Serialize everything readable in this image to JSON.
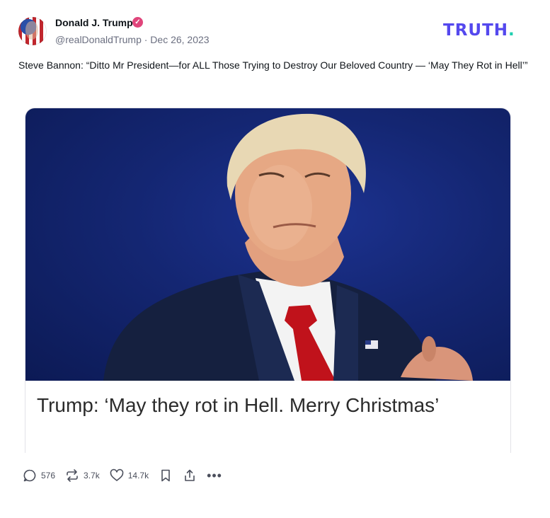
{
  "author": {
    "display_name": "Donald J. Trump",
    "handle_date": "@realDonaldTrump · Dec 26, 2023",
    "avatar_icon": "flag-portrait-avatar",
    "verified_icon": "verified-badge-icon",
    "verified_glyph": "✓"
  },
  "brand": {
    "logo_text": "TRUTH",
    "logo_dot": ".",
    "logo_color": "#5448ee",
    "dot_color": "#1fcfb0"
  },
  "post": {
    "text": "Steve Bannon: “Ditto Mr President—for ALL Those Trying to Destroy Our Beloved Country — ‘May They Rot in Hell’”"
  },
  "link_card": {
    "image_desc_icon": "article-photo",
    "title": "Trump: ‘May they rot in Hell. Merry Christmas’"
  },
  "actions": {
    "replies": "576",
    "retruths": "3.7k",
    "likes": "14.7k",
    "more_glyph": "•••"
  }
}
